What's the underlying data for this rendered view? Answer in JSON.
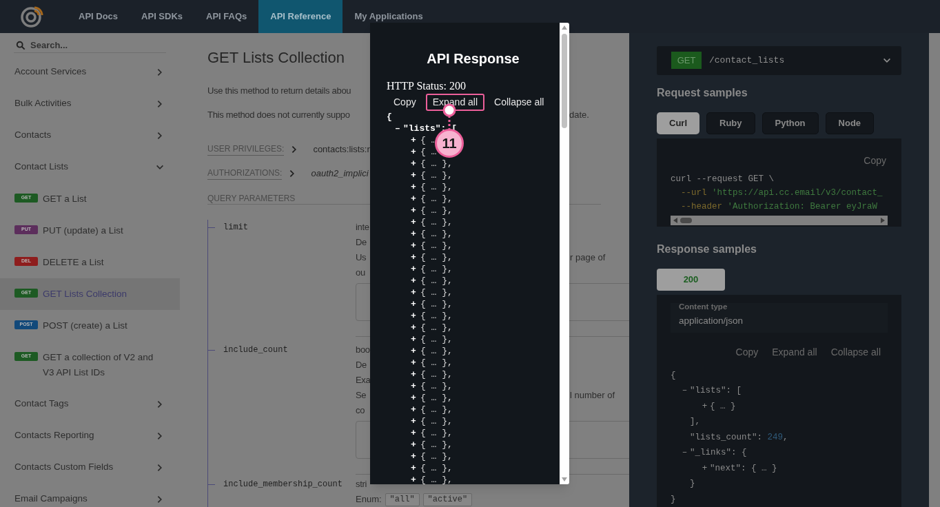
{
  "nav": {
    "tabs": [
      {
        "label": "API Docs",
        "selected": false
      },
      {
        "label": "API SDKs",
        "selected": false
      },
      {
        "label": "API FAQs",
        "selected": false
      },
      {
        "label": "API Reference",
        "selected": true
      },
      {
        "label": "My Applications",
        "selected": false
      }
    ]
  },
  "sidebar": {
    "search": {
      "placeholder": "Search..."
    },
    "items": [
      {
        "kind": "section",
        "label": "Account Services",
        "expanded": false
      },
      {
        "kind": "section",
        "label": "Bulk Activities",
        "expanded": false
      },
      {
        "kind": "section",
        "label": "Contacts",
        "expanded": false
      },
      {
        "kind": "section",
        "label": "Contact Lists",
        "expanded": true
      },
      {
        "kind": "endpoint",
        "method": "GET",
        "color": "#1d5a23",
        "label": "GET a List",
        "selected": false
      },
      {
        "kind": "endpoint",
        "method": "PUT",
        "color": "#5c2e5c",
        "label": "PUT (update) a List",
        "selected": false
      },
      {
        "kind": "endpoint",
        "method": "DEL",
        "color": "#8e1d1d",
        "label": "DELETE a List",
        "selected": false
      },
      {
        "kind": "endpoint",
        "method": "GET",
        "color": "#1d5a23",
        "label": "GET Lists Collection",
        "selected": true
      },
      {
        "kind": "endpoint",
        "method": "POST",
        "color": "#12497a",
        "label": "POST (create) a List",
        "selected": false
      },
      {
        "kind": "endpoint",
        "method": "GET",
        "color": "#1d5a23",
        "label": "GET a collection of V2 and V3 API List IDs",
        "selected": false
      },
      {
        "kind": "section",
        "label": "Contact Tags",
        "expanded": false
      },
      {
        "kind": "section",
        "label": "Contacts Reporting",
        "expanded": false
      },
      {
        "kind": "section",
        "label": "Contacts Custom Fields",
        "expanded": false
      },
      {
        "kind": "section",
        "label": "Email Campaigns",
        "expanded": false
      }
    ]
  },
  "content": {
    "title": "GET Lists Collection",
    "paragraphs": [
      {
        "left": "Use this method to return details abou"
      },
      {
        "left": "This method does not currently suppo",
        "right": "date."
      }
    ],
    "meta": [
      {
        "label": "USER PRIVILEGES:",
        "value": "contacts:lists:r",
        "italic": false
      },
      {
        "label": "AUTHORIZATIONS:",
        "value": "oauth2_implici",
        "italic": true
      }
    ],
    "section_heading": "QUERY PARAMETERS",
    "params": [
      {
        "name": "limit",
        "lines": [
          {
            "left": "inte"
          },
          {
            "left": "De"
          },
          {
            "left": "Us",
            "right": "r page of"
          },
          {
            "left": "ou"
          }
        ],
        "example_box": true
      },
      {
        "name": "include_count",
        "lines": [
          {
            "left": "boo"
          },
          {
            "left": "De"
          },
          {
            "left": "Exa"
          },
          {
            "left": "Se",
            "right": "l number of"
          },
          {
            "left": "co"
          }
        ],
        "example_box": true
      },
      {
        "name": "include_membership_count",
        "lines": [
          {
            "left": "stri"
          }
        ],
        "example_box": false,
        "enum_label": "Enum:",
        "enum": [
          "\"all\"",
          "\"active\""
        ]
      }
    ]
  },
  "modal": {
    "title": "API Response",
    "status": "HTTP Status: 200",
    "actions": [
      {
        "label": "Copy",
        "highlighted": false
      },
      {
        "label": "Expand all",
        "highlighted": true
      },
      {
        "label": "Collapse all",
        "highlighted": false
      }
    ],
    "open": "{",
    "list_toggle": "–",
    "list_key": "\"lists\": [",
    "callout": "11",
    "items": [
      {
        "toggle": "+",
        "text": "{ …"
      },
      {
        "toggle": "+",
        "text": "{ …"
      },
      {
        "toggle": "+",
        "text": "{ … },"
      },
      {
        "toggle": "+",
        "text": "{ … },"
      },
      {
        "toggle": "+",
        "text": "{ … },"
      },
      {
        "toggle": "+",
        "text": "{ … },"
      },
      {
        "toggle": "+",
        "text": "{ … },"
      },
      {
        "toggle": "+",
        "text": "{ … },"
      },
      {
        "toggle": "+",
        "text": "{ … },"
      },
      {
        "toggle": "+",
        "text": "{ … },"
      },
      {
        "toggle": "+",
        "text": "{ … },"
      },
      {
        "toggle": "+",
        "text": "{ … },"
      },
      {
        "toggle": "+",
        "text": "{ … },"
      },
      {
        "toggle": "+",
        "text": "{ … },"
      },
      {
        "toggle": "+",
        "text": "{ … },"
      },
      {
        "toggle": "+",
        "text": "{ … },"
      },
      {
        "toggle": "+",
        "text": "{ … },"
      },
      {
        "toggle": "+",
        "text": "{ … },"
      },
      {
        "toggle": "+",
        "text": "{ … },"
      },
      {
        "toggle": "+",
        "text": "{ … },"
      },
      {
        "toggle": "+",
        "text": "{ … },"
      },
      {
        "toggle": "+",
        "text": "{ … },"
      },
      {
        "toggle": "+",
        "text": "{ … },"
      },
      {
        "toggle": "+",
        "text": "{ … },"
      },
      {
        "toggle": "+",
        "text": "{ … },"
      },
      {
        "toggle": "+",
        "text": "{ … },"
      },
      {
        "toggle": "+",
        "text": "{ … },"
      },
      {
        "toggle": "+",
        "text": "{ … },"
      },
      {
        "toggle": "+",
        "text": "{ … },"
      },
      {
        "toggle": "+",
        "text": "{ … },"
      }
    ]
  },
  "right_panel": {
    "endpoint": {
      "method": "GET",
      "path": "/contact_lists"
    },
    "request_heading": "Request samples",
    "request_tabs": [
      {
        "label": "Curl",
        "selected": true
      },
      {
        "label": "Ruby",
        "selected": false
      },
      {
        "label": "Python",
        "selected": false
      },
      {
        "label": "Node",
        "selected": false
      }
    ],
    "request_copy": "Copy",
    "request_code": [
      {
        "parts": [
          {
            "kind": "plain",
            "text": "curl --request GET \\"
          }
        ]
      },
      {
        "parts": [
          {
            "kind": "flag",
            "text": "  --url"
          },
          {
            "kind": "string",
            "text": " 'https://api.cc.email/v3/contact_"
          }
        ]
      },
      {
        "parts": [
          {
            "kind": "flag",
            "text": "  --header"
          },
          {
            "kind": "string",
            "text": " 'Authorization: Bearer eyJraW"
          }
        ]
      }
    ],
    "response_heading": "Response samples",
    "response_tabs": [
      {
        "label": "200",
        "selected": true
      }
    ],
    "content_type_label": "Content type",
    "content_type": "application/json",
    "response_actions": [
      "Copy",
      "Expand all",
      "Collapse all"
    ],
    "response_json": {
      "open": "{",
      "close": "}",
      "entries": [
        {
          "toggle": "–",
          "text": "\"lists\": [",
          "children": [
            {
              "toggle": "+",
              "text": "{ … }"
            }
          ],
          "close": "],"
        },
        {
          "text": "\"lists_count\": ",
          "number": "249",
          "suffix": ","
        },
        {
          "toggle": "–",
          "text": "\"_links\": {",
          "children": [
            {
              "toggle": "+",
              "text": "\"next\": { … }"
            }
          ],
          "close": "}"
        }
      ]
    }
  }
}
